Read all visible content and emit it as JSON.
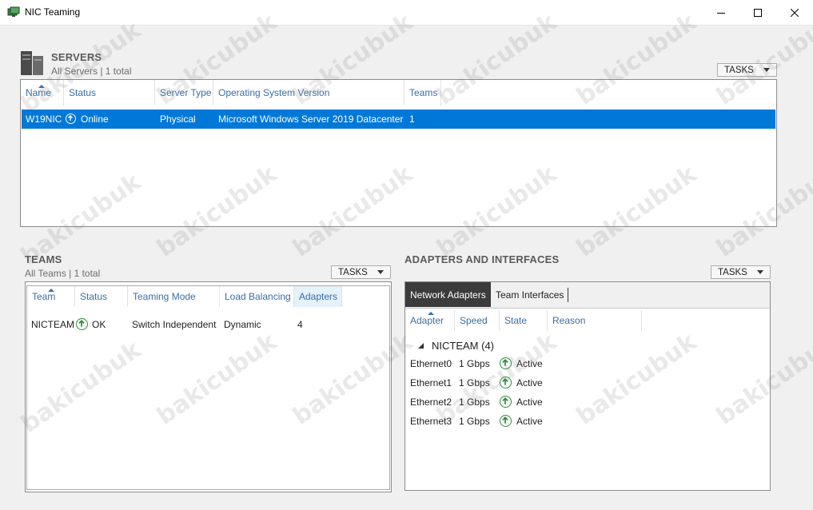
{
  "window": {
    "title": "NIC Teaming",
    "app_icon": "nic-teaming-icon"
  },
  "servers": {
    "title": "SERVERS",
    "subtitle": "All Servers | 1 total",
    "tasks_label": "TASKS",
    "columns": [
      "Name",
      "Status",
      "Server Type",
      "Operating System Version",
      "Teams"
    ],
    "rows": [
      {
        "name": "W19NIC",
        "status": "Online",
        "server_type": "Physical",
        "os": "Microsoft Windows Server 2019 Datacenter",
        "teams": "1"
      }
    ]
  },
  "teams": {
    "title": "TEAMS",
    "subtitle": "All Teams | 1 total",
    "tasks_label": "TASKS",
    "columns": [
      "Team",
      "Status",
      "Teaming Mode",
      "Load Balancing",
      "Adapters"
    ],
    "rows": [
      {
        "team": "NICTEAM",
        "status": "OK",
        "mode": "Switch Independent",
        "load_balancing": "Dynamic",
        "adapters": "4"
      }
    ]
  },
  "adapters": {
    "title": "ADAPTERS AND INTERFACES",
    "tasks_label": "TASKS",
    "tabs": [
      "Network Adapters",
      "Team Interfaces"
    ],
    "columns": [
      "Adapter",
      "Speed",
      "State",
      "Reason"
    ],
    "group_label": "NICTEAM (4)",
    "rows": [
      {
        "adapter": "Ethernet0",
        "speed": "1 Gbps",
        "state": "Active"
      },
      {
        "adapter": "Ethernet1",
        "speed": "1 Gbps",
        "state": "Active"
      },
      {
        "adapter": "Ethernet2",
        "speed": "1 Gbps",
        "state": "Active"
      },
      {
        "adapter": "Ethernet3",
        "speed": "1 Gbps",
        "state": "Active"
      }
    ]
  },
  "watermark": "bakicubuk",
  "colors": {
    "selection": "#0078d7",
    "status_ok": "#2e8b3e",
    "header_link": "#3a6ea5"
  }
}
